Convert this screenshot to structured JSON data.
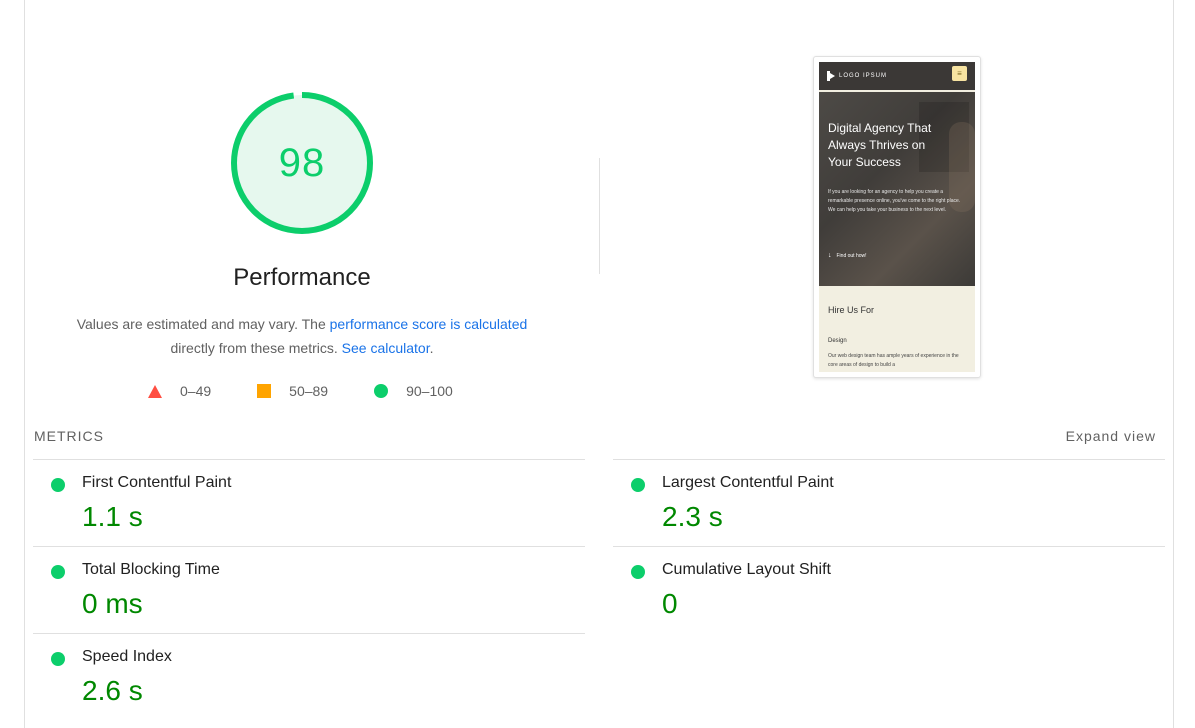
{
  "score": {
    "value": "98",
    "fraction": 0.98,
    "color": "#0cce6b"
  },
  "title": "Performance",
  "description": {
    "text1": "Values are estimated and may vary. The ",
    "link1": "performance score is calculated",
    "text2": "directly from these metrics. ",
    "link2": "See calculator",
    "text3": "."
  },
  "legend": [
    {
      "range": "0–49",
      "shape": "triangle",
      "color": "#ff4e42"
    },
    {
      "range": "50–89",
      "shape": "square",
      "color": "#ffa400"
    },
    {
      "range": "90–100",
      "shape": "circle",
      "color": "#0cce6b"
    }
  ],
  "thumbnail": {
    "logo": "LOGO IPSUM",
    "hero_title": "Digital Agency That Always Thrives on Your Success",
    "hero_text": "If you are looking for an agency to help you create a remarkable presence online, you've come to the right place. We can help you take your business to the next level.",
    "hero_link": "Find out how!",
    "section_title": "Hire Us For",
    "design_label": "Design",
    "design_text": "Our web design team has ample years of experience in the core areas of design to build a"
  },
  "metrics": {
    "label": "METRICS",
    "expand": "Expand view",
    "items": [
      {
        "name": "First Contentful Paint",
        "value": "1.1 s"
      },
      {
        "name": "Largest Contentful Paint",
        "value": "2.3 s"
      },
      {
        "name": "Total Blocking Time",
        "value": "0 ms"
      },
      {
        "name": "Cumulative Layout Shift",
        "value": "0"
      },
      {
        "name": "Speed Index",
        "value": "2.6 s"
      }
    ]
  }
}
